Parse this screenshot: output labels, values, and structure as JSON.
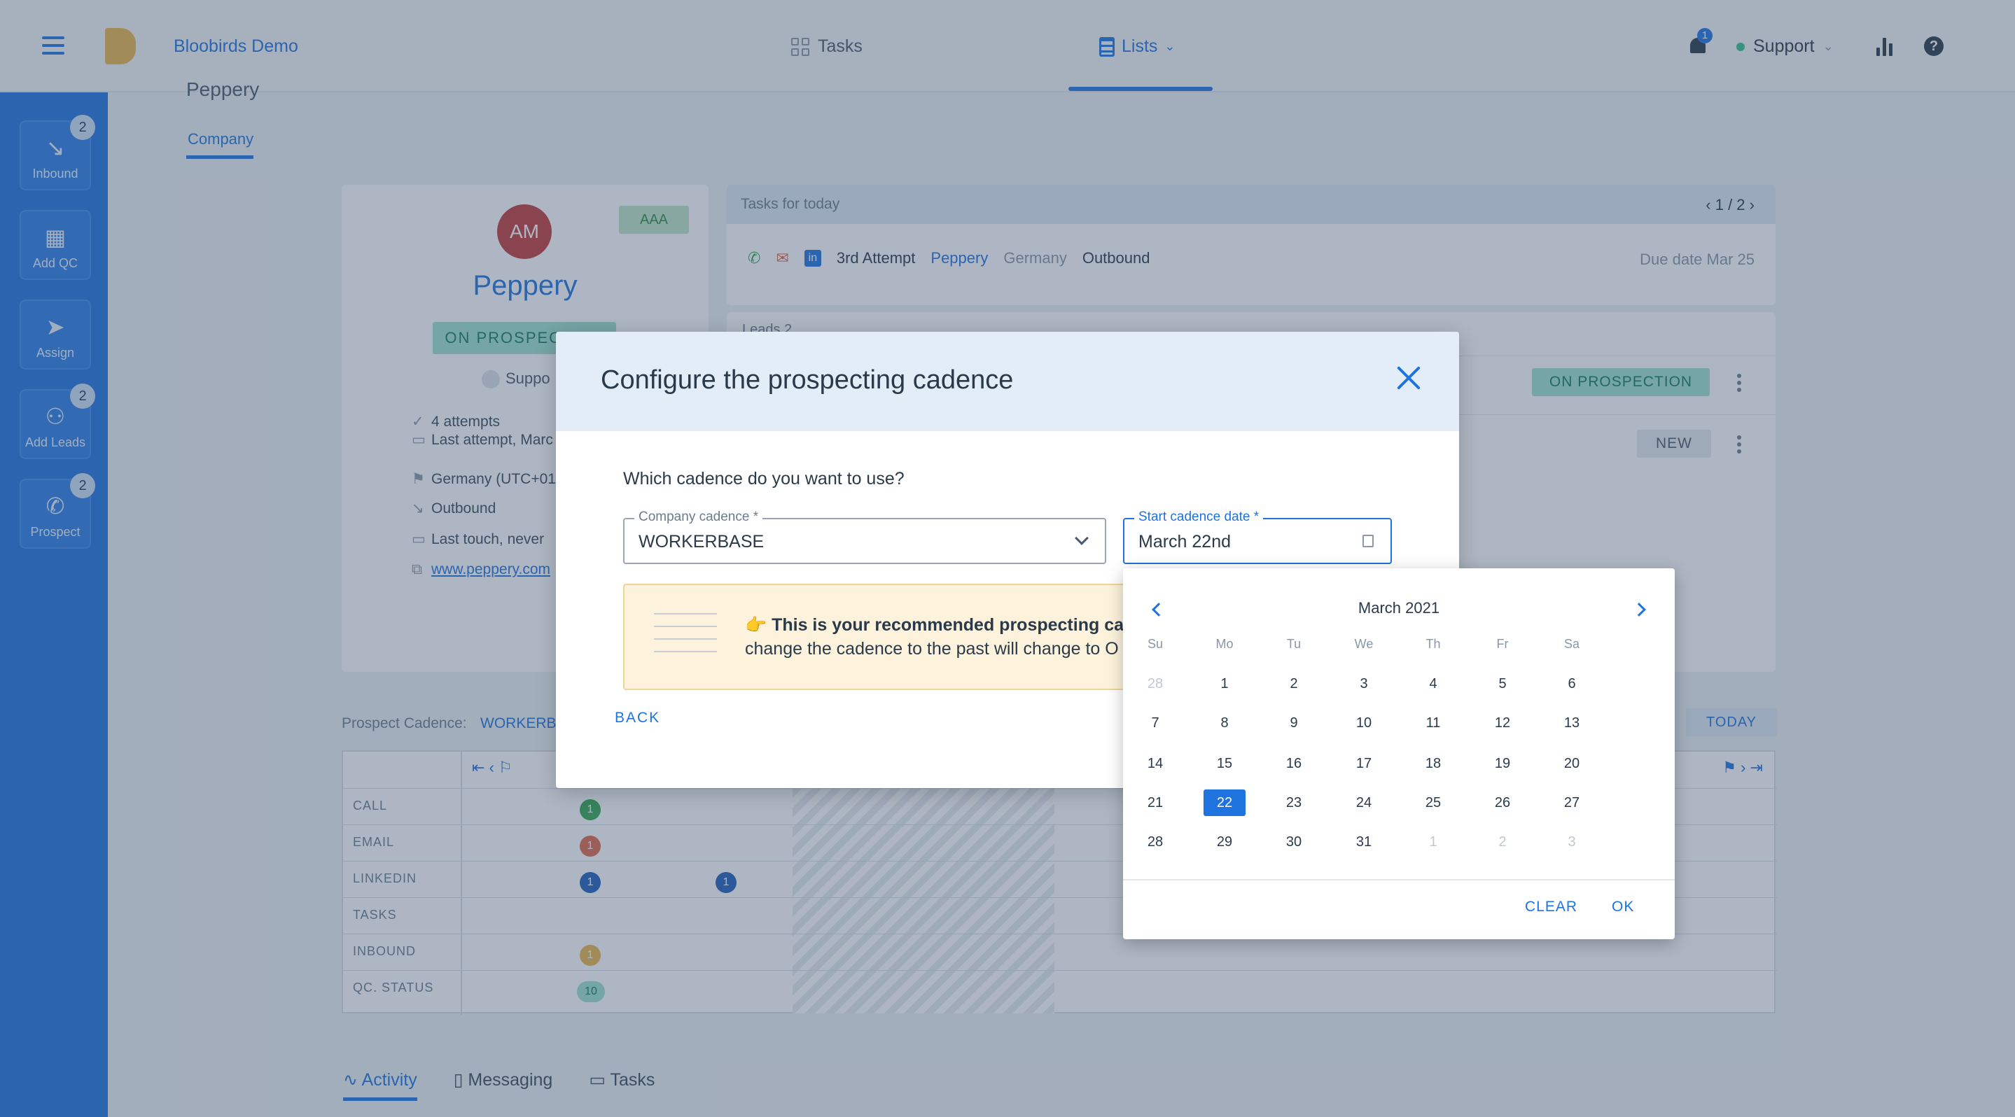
{
  "topbar": {
    "brand": "Bloobirds Demo",
    "nav_tasks": "Tasks",
    "nav_lists": "Lists",
    "notification_count": "1",
    "user": "Support"
  },
  "sidebar": {
    "items": [
      {
        "label": "Inbound",
        "count": "2",
        "icon": "arrow-down-right-icon"
      },
      {
        "label": "Add QC",
        "count": "",
        "icon": "building-icon"
      },
      {
        "label": "Assign",
        "count": "",
        "icon": "send-icon"
      },
      {
        "label": "Add Leads",
        "count": "2",
        "icon": "add-user-icon"
      },
      {
        "label": "Prospect",
        "count": "2",
        "icon": "phone-icon"
      }
    ]
  },
  "page": {
    "breadcrumb": "Peppery",
    "tab": "Company"
  },
  "company": {
    "initials": "AM",
    "tier": "AAA",
    "name": "Peppery",
    "status": "ON PROSPECTION",
    "owner": "Suppo",
    "attributes": [
      "4 attempts",
      "Last attempt, Marc",
      "Germany (UTC+01",
      "Outbound",
      "Last touch, never",
      "www.peppery.com"
    ]
  },
  "tasks_card": {
    "title": "Tasks for today",
    "pager": "1 / 2",
    "task_attempt": "3rd Attempt",
    "task_company": "Peppery",
    "task_country": "Germany",
    "task_source": "Outbound",
    "due": "Due date Mar 25"
  },
  "leads_card": {
    "header": "Leads 2",
    "lead1_status": "ON PROSPECTION",
    "lead2_status": "NEW"
  },
  "cadence": {
    "label": "Prospect Cadence:",
    "value": "WORKERB...",
    "today": "TODAY",
    "rows": [
      "CALL",
      "EMAIL",
      "LINKEDIN",
      "TASKS",
      "INBOUND",
      "QC. STATUS"
    ],
    "bubbles": {
      "call": "1",
      "email": "1",
      "linkedin": "1",
      "linkedin2": "1",
      "inbound": "1",
      "qc": "10"
    }
  },
  "bottom_tabs": [
    "Activity",
    "Messaging",
    "Tasks"
  ],
  "modal": {
    "title": "Configure the prospecting cadence",
    "question": "Which cadence do you want to use?",
    "cadence_label": "Company cadence *",
    "cadence_value": "WORKERBASE",
    "date_label": "Start cadence date *",
    "date_value": "March 22nd",
    "reco_line1": "This is your recommended prospecting cade",
    "reco_line2": "change the cadence to the past will change to O",
    "reco_emoji": "👉",
    "back": "BACK"
  },
  "datepicker": {
    "month": "March 2021",
    "weekdays": [
      "Su",
      "Mo",
      "Tu",
      "We",
      "Th",
      "Fr",
      "Sa"
    ],
    "weeks": [
      [
        "28",
        "1",
        "2",
        "3",
        "4",
        "5",
        "6"
      ],
      [
        "7",
        "8",
        "9",
        "10",
        "11",
        "12",
        "13"
      ],
      [
        "14",
        "15",
        "16",
        "17",
        "18",
        "19",
        "20"
      ],
      [
        "21",
        "22",
        "23",
        "24",
        "25",
        "26",
        "27"
      ],
      [
        "28",
        "29",
        "30",
        "31",
        "1",
        "2",
        "3"
      ]
    ],
    "selected": "22",
    "clear": "CLEAR",
    "ok": "OK"
  },
  "colors": {
    "accent": "#1f73de",
    "prospection": "#9fe2cf",
    "tier": "#bfe6c6",
    "avatar": "#c23b3b"
  }
}
